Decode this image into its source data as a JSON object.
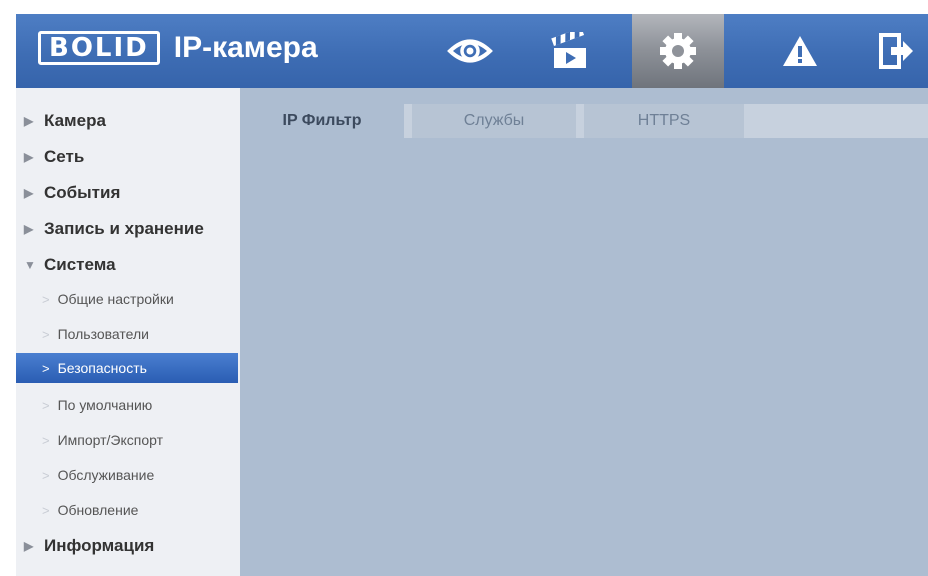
{
  "header": {
    "logo_text": "BOLID",
    "title": "IP-камера",
    "nav": [
      {
        "name": "live",
        "icon": "eye-icon"
      },
      {
        "name": "playback",
        "icon": "clapperboard-icon"
      },
      {
        "name": "settings",
        "icon": "gear-icon",
        "active": true
      },
      {
        "name": "alarm",
        "icon": "warning-icon"
      },
      {
        "name": "logout",
        "icon": "exit-icon"
      }
    ]
  },
  "sidebar": {
    "items": [
      {
        "label": "Камера",
        "level": "top",
        "expanded": false
      },
      {
        "label": "Сеть",
        "level": "top",
        "expanded": false
      },
      {
        "label": "События",
        "level": "top",
        "expanded": false
      },
      {
        "label": "Запись и хранение",
        "level": "top",
        "expanded": false
      },
      {
        "label": "Система",
        "level": "top",
        "expanded": true
      },
      {
        "label": "Общие настройки",
        "level": "sub"
      },
      {
        "label": "Пользователи",
        "level": "sub"
      },
      {
        "label": "Безопасность",
        "level": "sub",
        "selected": true
      },
      {
        "label": "По умолчанию",
        "level": "sub"
      },
      {
        "label": "Импорт/Экспорт",
        "level": "sub"
      },
      {
        "label": "Обслуживание",
        "level": "sub"
      },
      {
        "label": "Обновление",
        "level": "sub"
      },
      {
        "label": "Информация",
        "level": "top",
        "expanded": false
      }
    ]
  },
  "tabs": [
    {
      "label": "IP Фильтр",
      "active": true
    },
    {
      "label": "Службы",
      "active": false
    },
    {
      "label": "HTTPS",
      "active": false
    }
  ],
  "colors": {
    "header_blue": "#3e6db4",
    "content_bg": "#adbdd1",
    "selected_item": "#2f63b8"
  }
}
